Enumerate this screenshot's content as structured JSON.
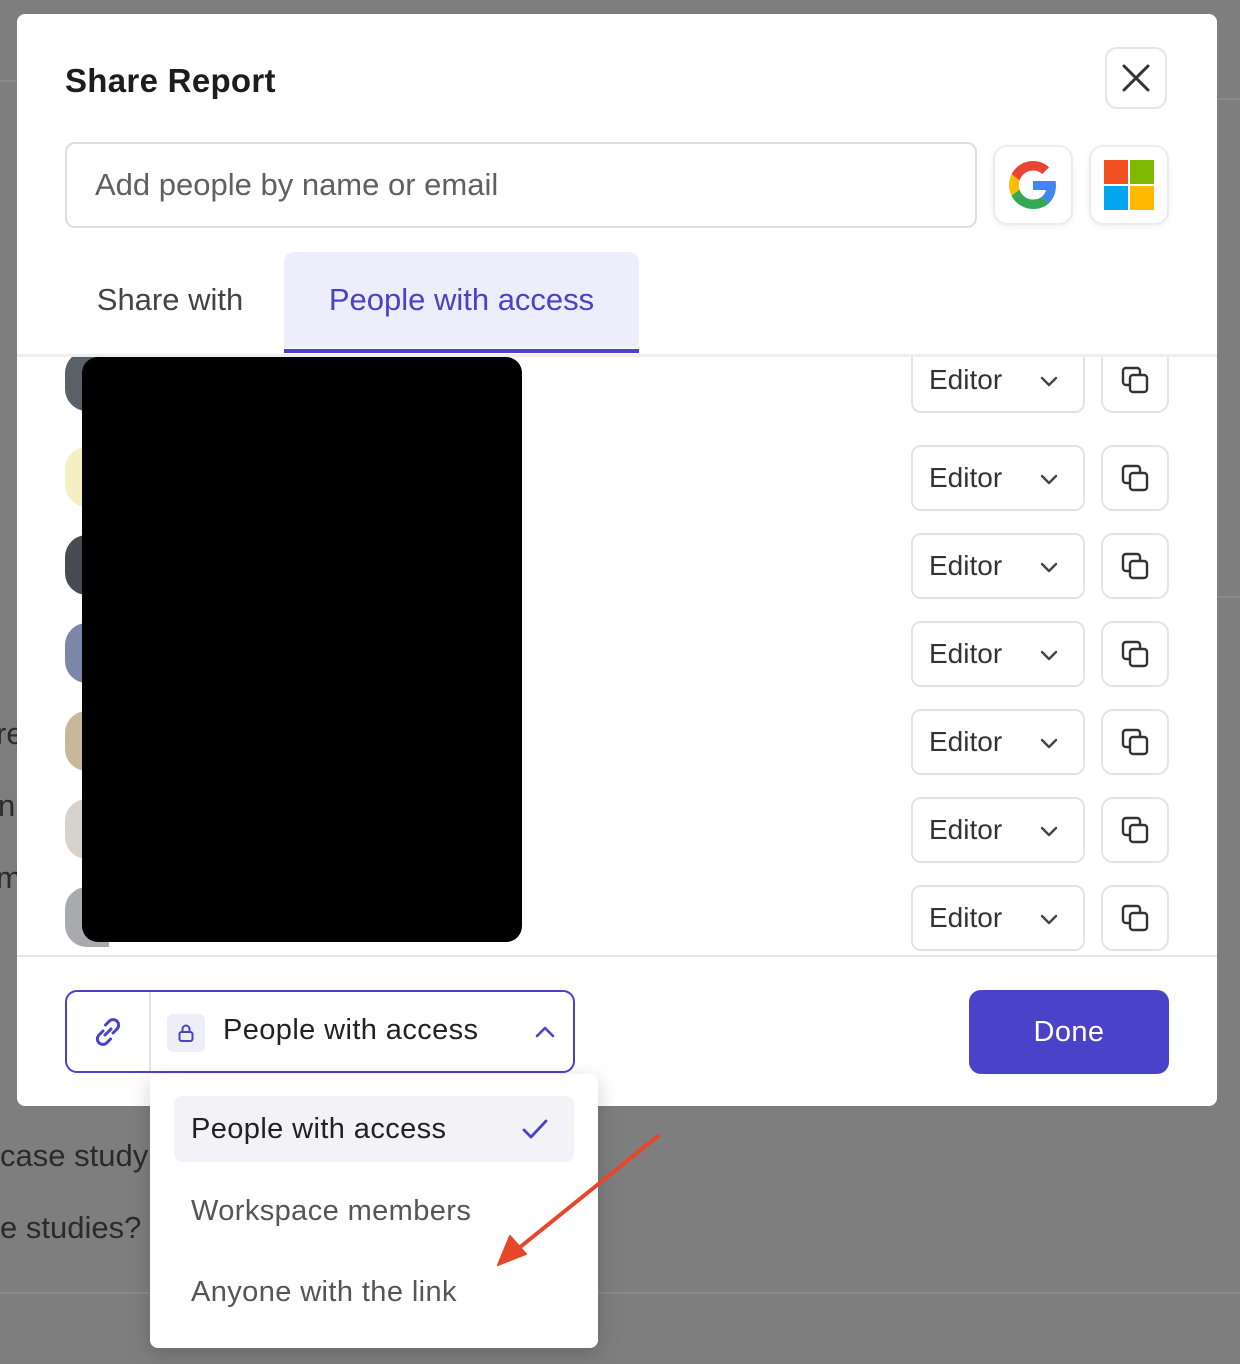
{
  "background": {
    "snippets": [
      "re",
      "n",
      "m",
      "case study",
      "e studies?"
    ]
  },
  "dialog": {
    "title": "Share Report",
    "close_icon": "close-icon",
    "search": {
      "placeholder": "Add people by name or email",
      "value": ""
    },
    "providers": [
      {
        "name": "google",
        "icon": "google-logo"
      },
      {
        "name": "microsoft",
        "icon": "microsoft-logo"
      }
    ],
    "tabs": [
      {
        "label": "Share with",
        "active": false
      },
      {
        "label": "People with access",
        "active": true
      }
    ],
    "members": [
      {
        "role": "Editor"
      },
      {
        "role": "Editor"
      },
      {
        "role": "Editor"
      },
      {
        "role": "Editor"
      },
      {
        "role": "Editor"
      },
      {
        "role": "Editor"
      },
      {
        "role": "Editor"
      }
    ],
    "link_access": {
      "selected": "People with access",
      "options": [
        {
          "label": "People with access",
          "selected": true
        },
        {
          "label": "Workspace members",
          "selected": false
        },
        {
          "label": "Anyone with the link",
          "selected": false
        }
      ]
    },
    "done_label": "Done"
  },
  "colors": {
    "accent": "#4a42c9",
    "tab_active_bg": "#ededfb",
    "annotation_arrow": "#e8462b"
  }
}
